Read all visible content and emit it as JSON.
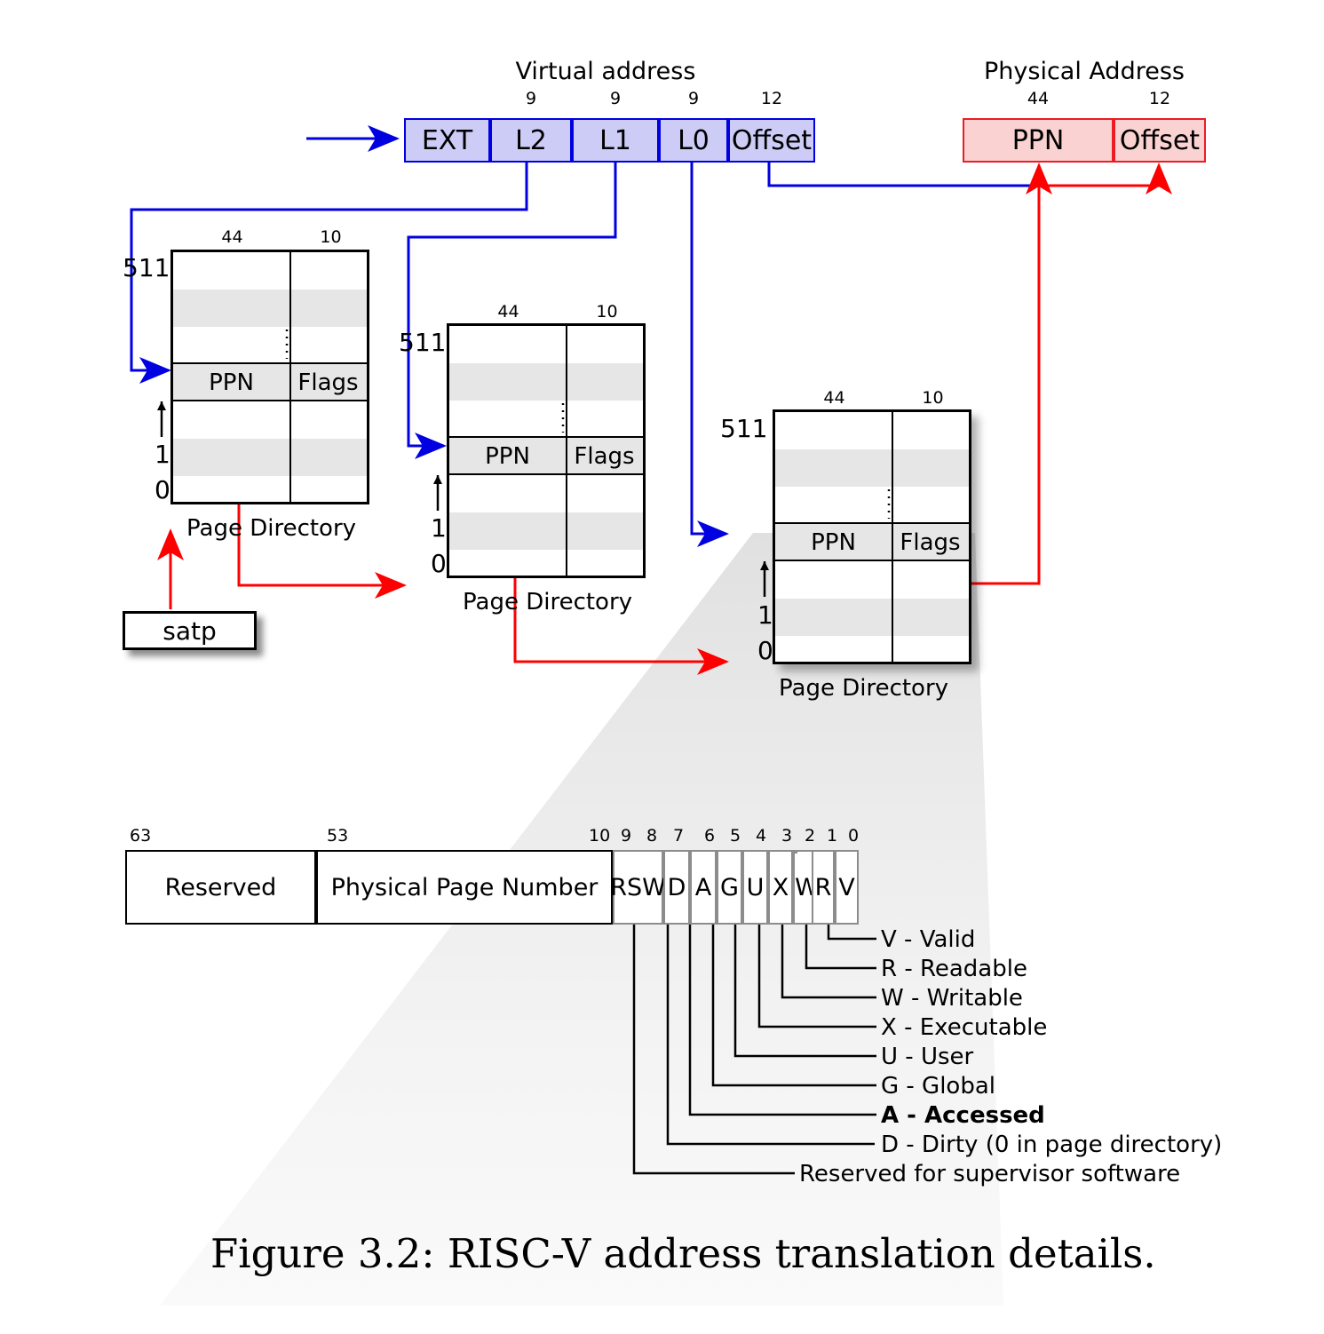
{
  "figure": {
    "caption": "Figure 3.2: RISC-V address translation details."
  },
  "virtual_address": {
    "title": "Virtual address",
    "fields": [
      {
        "label": "EXT",
        "bits": ""
      },
      {
        "label": "L2",
        "bits": "9"
      },
      {
        "label": "L1",
        "bits": "9"
      },
      {
        "label": "L0",
        "bits": "9"
      },
      {
        "label": "Offset",
        "bits": "12"
      }
    ]
  },
  "physical_address": {
    "title": "Physical Address",
    "fields": [
      {
        "label": "PPN",
        "bits": "44"
      },
      {
        "label": "Offset",
        "bits": "12"
      }
    ]
  },
  "page_directories": [
    {
      "name": "Page Directory",
      "col_bits": [
        "44",
        "10"
      ],
      "top_index": "511",
      "row_indices": [
        "1",
        "0"
      ],
      "entry_cols": [
        "PPN",
        "Flags"
      ]
    },
    {
      "name": "Page Directory",
      "col_bits": [
        "44",
        "10"
      ],
      "top_index": "511",
      "row_indices": [
        "1",
        "0"
      ],
      "entry_cols": [
        "PPN",
        "Flags"
      ]
    },
    {
      "name": "Page Directory",
      "col_bits": [
        "44",
        "10"
      ],
      "top_index": "511",
      "row_indices": [
        "1",
        "0"
      ],
      "entry_cols": [
        "PPN",
        "Flags"
      ]
    }
  ],
  "satp": {
    "label": "satp"
  },
  "pte": {
    "fields": [
      {
        "label": "Reserved",
        "start_bit": "63"
      },
      {
        "label": "Physical Page Number",
        "start_bit": "53"
      }
    ],
    "bits": [
      {
        "label": "RSW",
        "nums": [
          "9",
          "8"
        ]
      },
      {
        "label": "D",
        "nums": [
          "7"
        ]
      },
      {
        "label": "A",
        "nums": [
          "6"
        ]
      },
      {
        "label": "G",
        "nums": [
          "5"
        ]
      },
      {
        "label": "U",
        "nums": [
          "4"
        ]
      },
      {
        "label": "X",
        "nums": [
          "3"
        ]
      },
      {
        "label": "W",
        "nums": [
          "2"
        ]
      },
      {
        "label": "R",
        "nums": [
          "1"
        ]
      },
      {
        "label": "V",
        "nums": [
          "0"
        ]
      }
    ],
    "ppn_end_bit": "10",
    "legend": [
      {
        "text": "V - Valid",
        "bold": false
      },
      {
        "text": "R  - Readable",
        "bold": false
      },
      {
        "text": "W - Writable",
        "bold": false
      },
      {
        "text": "X - Executable",
        "bold": false
      },
      {
        "text": "U - User",
        "bold": false
      },
      {
        "text": "G - Global",
        "bold": false
      },
      {
        "text": "A - Accessed",
        "bold": true
      },
      {
        "text": "D - Dirty (0 in page directory)",
        "bold": false
      },
      {
        "text": "Reserved for supervisor software",
        "bold": false
      }
    ]
  },
  "colors": {
    "virtual_fill": "#ccccf7",
    "virtual_stroke": "#0000e0",
    "physical_fill": "#fbd2d2",
    "physical_stroke": "#ec1c24",
    "band": "#e6e6e6",
    "arrow_blue": "#0000e0",
    "arrow_red": "#ff0000",
    "dot_red": "#ff0000"
  }
}
